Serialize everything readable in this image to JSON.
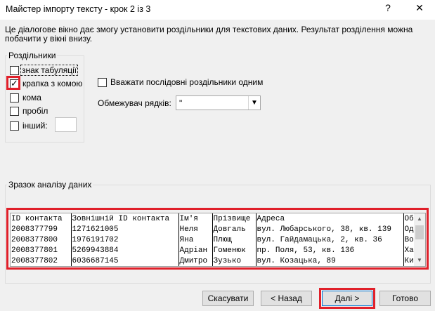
{
  "window": {
    "title": "Майстер імпорту тексту - крок 2 із 3",
    "help_glyph": "?",
    "close_glyph": "✕"
  },
  "intro_text": "Це діалогове вікно дає змогу установити роздільники для текстових даних. Результат розділення можна побачити у вікні внизу.",
  "delimiters": {
    "group_label": "Роздільники",
    "tab": {
      "label": "знак табуляції",
      "checked": false
    },
    "comma": {
      "label": "крапка з комою",
      "checked": true
    },
    "comma2": {
      "label": "кома",
      "checked": false
    },
    "space": {
      "label": "пробіл",
      "checked": false
    },
    "other": {
      "label": "інший:",
      "checked": false,
      "value": ""
    }
  },
  "consecutive": {
    "label": "Вважати послідовні роздільники одним",
    "checked": false
  },
  "text_qualifier": {
    "label": "Обмежувач рядків:",
    "value": "\""
  },
  "preview": {
    "label": "Зразок аналізу даних",
    "rows": [
      [
        "ID контакта",
        "Зовнішній ID контакта",
        "Ім'я",
        "Прізвище",
        "Адреса",
        "Об"
      ],
      [
        "2008377799",
        "1271621005",
        "Неля",
        "Довгаль",
        "вул. Любарського, 38, кв. 139",
        "Од"
      ],
      [
        "2008377800",
        "1976191702",
        "Яна",
        "Плющ",
        "вул. Гайдамацька, 2, кв. 36",
        "Во"
      ],
      [
        "2008377801",
        "5269943884",
        "Адріан",
        "Гоменюк",
        "пр. Поля, 53, кв. 136",
        "Ха"
      ],
      [
        "2008377802",
        "6036687145",
        "Дмитро",
        "Зузько",
        "вул. Козацька, 89",
        "Ки"
      ]
    ]
  },
  "buttons": {
    "cancel": "Скасувати",
    "back": "< Назад",
    "next": "Далі >",
    "finish": "Готово"
  },
  "colors": {
    "highlight": "#e0202a",
    "focus": "#0078d7"
  }
}
